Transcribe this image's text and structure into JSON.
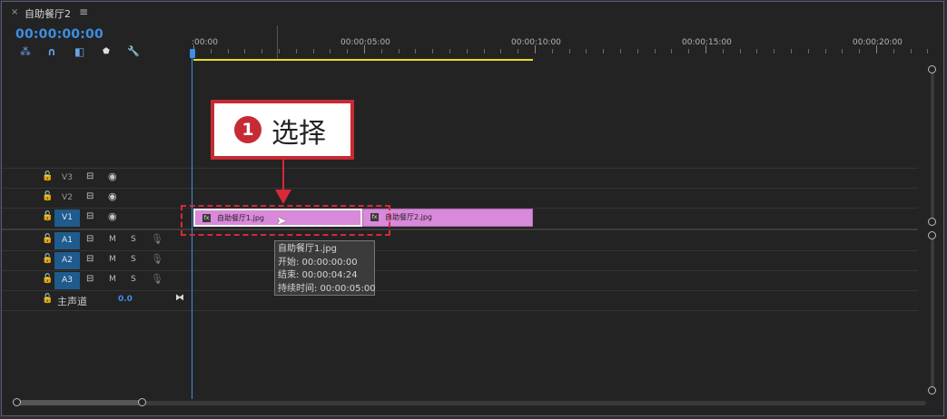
{
  "tab": {
    "close": "×",
    "title": "自助餐厅2",
    "menu": "≡"
  },
  "timecode": "00:00:00:00",
  "toolbar": [
    {
      "name": "snap-icon",
      "glyph": "⁂"
    },
    {
      "name": "linked-selection-icon",
      "glyph": "∩"
    },
    {
      "name": "add-marker-icon",
      "glyph": "◧"
    },
    {
      "name": "marker-icon",
      "glyph": "⬟"
    },
    {
      "name": "wrench-icon",
      "glyph": "🔧"
    }
  ],
  "ruler": {
    "labels": [
      ":00:00",
      "00:00:05:00",
      "00:00:10:00",
      "00:00:15:00",
      "00:00:20:00"
    ]
  },
  "video_tracks": [
    {
      "label": "V3",
      "active": false
    },
    {
      "label": "V2",
      "active": false
    },
    {
      "label": "V1",
      "active": true
    }
  ],
  "audio_tracks": [
    {
      "label": "A1",
      "m": "M",
      "s": "S"
    },
    {
      "label": "A2",
      "m": "M",
      "s": "S"
    },
    {
      "label": "A3",
      "m": "M",
      "s": "S"
    }
  ],
  "master": {
    "label": "主声道",
    "value": "0.0"
  },
  "clips": [
    {
      "name": "自助餐厅1.jpg",
      "fx": "fx",
      "selected": true,
      "start": 0,
      "end": 5
    },
    {
      "name": "自助餐厅2.jpg",
      "fx": "fx",
      "selected": false,
      "start": 5,
      "end": 10
    }
  ],
  "callout": {
    "number": "1",
    "text": "选择"
  },
  "tooltip": {
    "name": "自助餐厅1.jpg",
    "start": "开始: 00:00:00:00",
    "end": "结束: 00:00:04:24",
    "duration": "持续时间: 00:00:05:00"
  },
  "colors": {
    "accent": "#3d8ee0",
    "clip": "#d889d9",
    "workbar": "#e6dc2a",
    "highlight": "#d8283a"
  }
}
